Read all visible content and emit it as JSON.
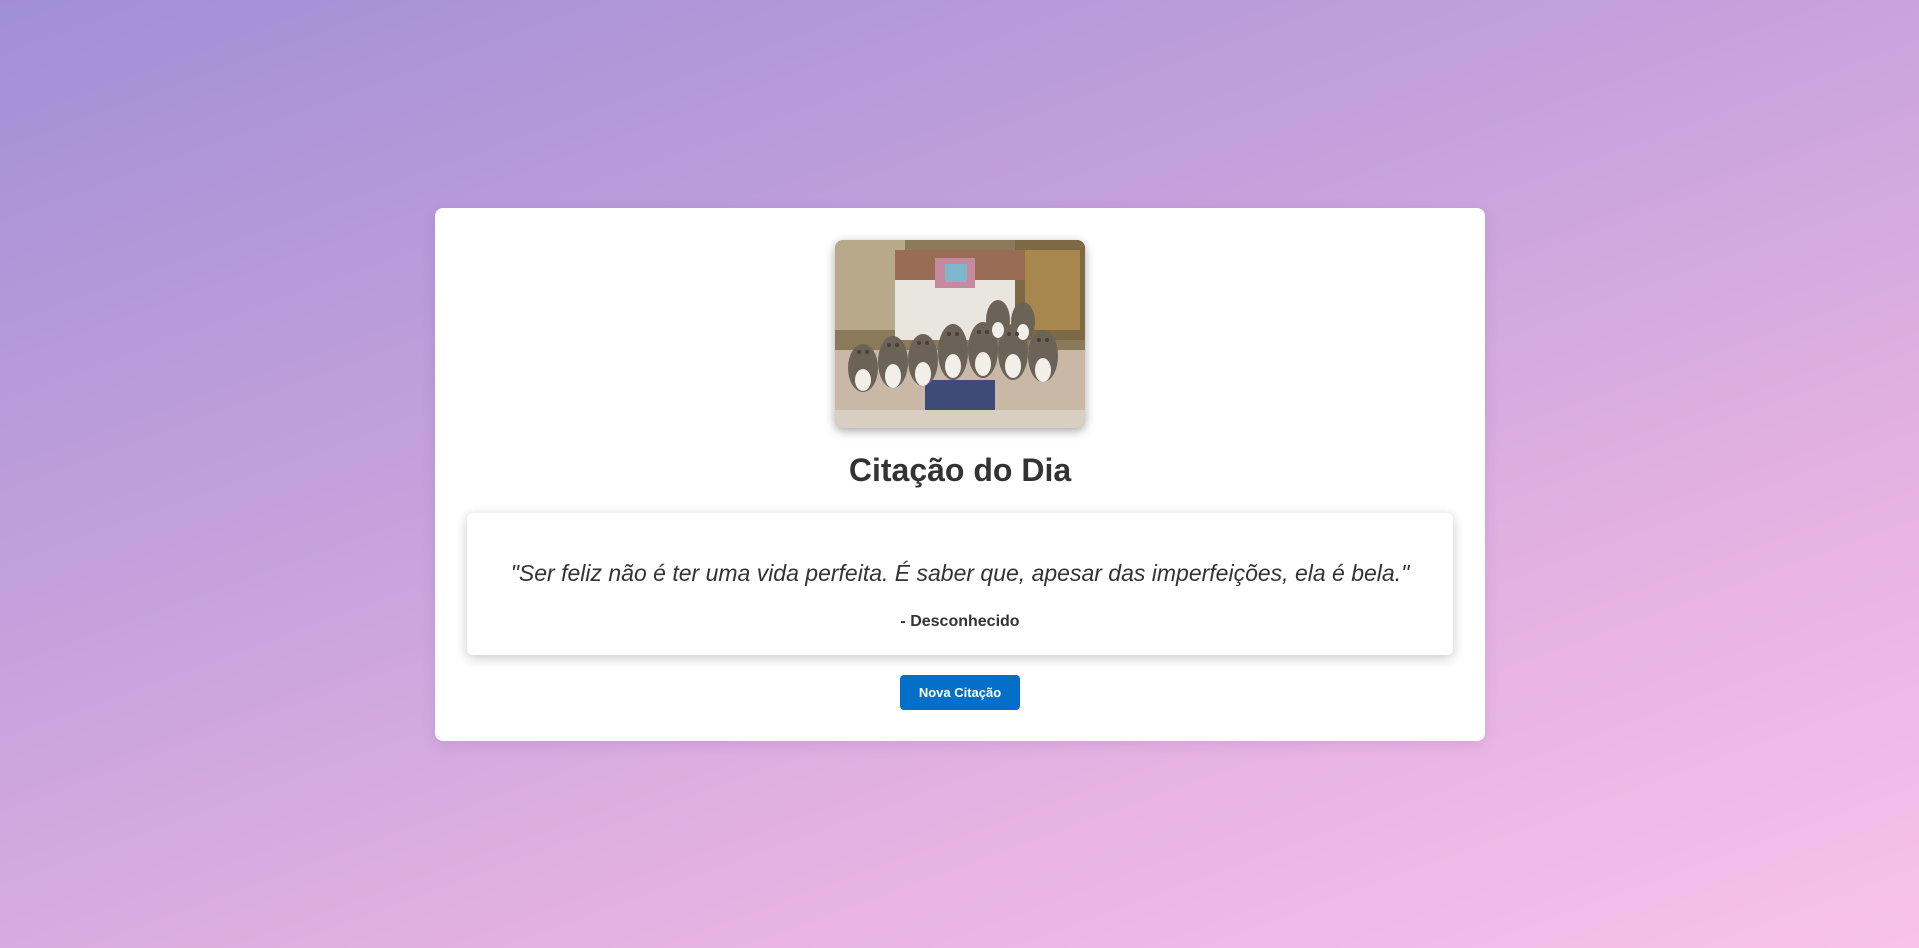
{
  "card": {
    "title": "Citação do Dia",
    "image_alt": "kittens-on-bed-photo",
    "quote": {
      "text": "\"Ser feliz não é ter uma vida perfeita. É saber que, apesar das imperfeições, ela é bela.\"",
      "author": "- Desconhecido"
    },
    "button_label": "Nova Citação"
  },
  "colors": {
    "background_start": "#a18fd6",
    "background_end": "#f8c2ea",
    "button": "#0270c9",
    "text": "#333333"
  }
}
